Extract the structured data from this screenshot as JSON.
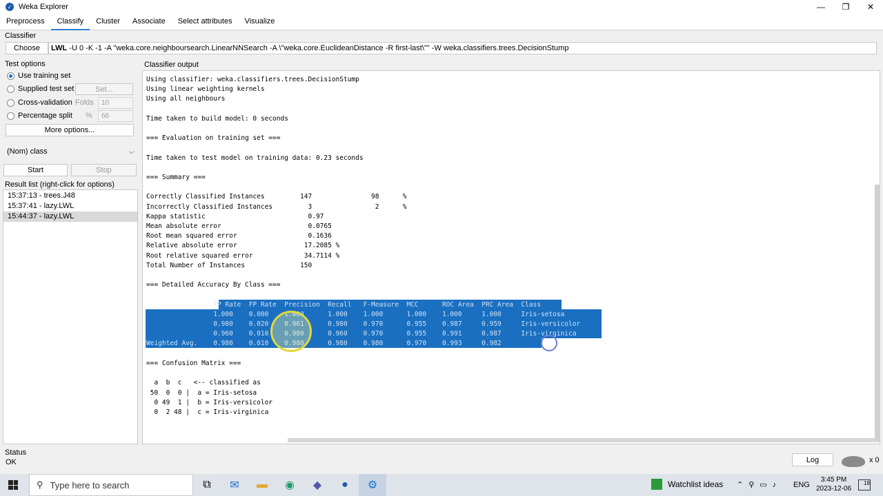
{
  "window": {
    "title": "Weka Explorer",
    "minimize": "—",
    "maximize": "❐",
    "close": "✕"
  },
  "tabs": [
    "Preprocess",
    "Classify",
    "Cluster",
    "Associate",
    "Select attributes",
    "Visualize"
  ],
  "classifier": {
    "section": "Classifier",
    "choose": "Choose",
    "name": "LWL",
    "args": " -U 0 -K -1 -A \"weka.core.neighboursearch.LinearNNSearch -A \\\"weka.core.EuclideanDistance -R first-last\\\"\" -W weka.classifiers.trees.DecisionStump"
  },
  "test_options": {
    "section": "Test options",
    "use_training": "Use training set",
    "supplied": "Supplied test set",
    "set_btn": "Set...",
    "cross": "Cross-validation",
    "folds_label": "Folds",
    "folds_value": "10",
    "pct_split": "Percentage split",
    "pct_label": "%",
    "pct_value": "66",
    "more": "More options..."
  },
  "class_select": "(Nom) class",
  "start": "Start",
  "stop": "Stop",
  "result_list": {
    "section": "Result list (right-click for options)",
    "items": [
      "15:37:13 - trees.J48",
      "15:37:41 - lazy.LWL",
      "15:44:37 - lazy.LWL"
    ]
  },
  "output": {
    "section": "Classifier output",
    "pre_lines": "Using classifier: weka.classifiers.trees.DecisionStump\nUsing linear weighting kernels\nUsing all neighbours\n\nTime taken to build model: 0 seconds\n\n=== Evaluation on training set ===\n\nTime taken to test model on training data: 0.23 seconds\n\n=== Summary ===\n\nCorrectly Classified Instances         147               98      %\nIncorrectly Classified Instances         3                2      %\nKappa statistic                          0.97\nMean absolute error                      0.0765\nRoot mean squared error                  0.1636\nRelative absolute error                 17.2085 %\nRoot relative squared error             34.7114 %\nTotal Number of Instances              150\n\n=== Detailed Accuracy By Class ===\n",
    "accuracy_lines": "                 TP Rate  FP Rate  Precision  Recall   F-Measure  MCC      ROC Area  PRC Area  Class\n                 1.000    0.000    1.000      1.000    1.000      1.000    1.000     1.000     Iris-setosa\n                 0.980    0.020    0.961      0.980    0.970      0.955    0.987     0.959     Iris-versicolor\n                 0.960    0.010    0.980      0.960    0.970      0.955    0.991     0.987     Iris-virginica\nWeighted Avg.    0.980    0.010    0.980      0.980    0.980      0.970    0.993     0.982",
    "post_lines": "\n=== Confusion Matrix ===\n\n  a  b  c   <-- classified as\n 50  0  0 |  a = Iris-setosa\n  0 49  1 |  b = Iris-versicolor\n  0  2 48 |  c = Iris-virginica"
  },
  "status": {
    "label": "Status",
    "value": "OK",
    "log": "Log",
    "count": "x 0"
  },
  "taskbar": {
    "search": "Type here to search",
    "watchlist": "Watchlist ideas",
    "lang": "ENG",
    "time": "3:45 PM",
    "date": "2023-12-06",
    "notif": "18"
  }
}
